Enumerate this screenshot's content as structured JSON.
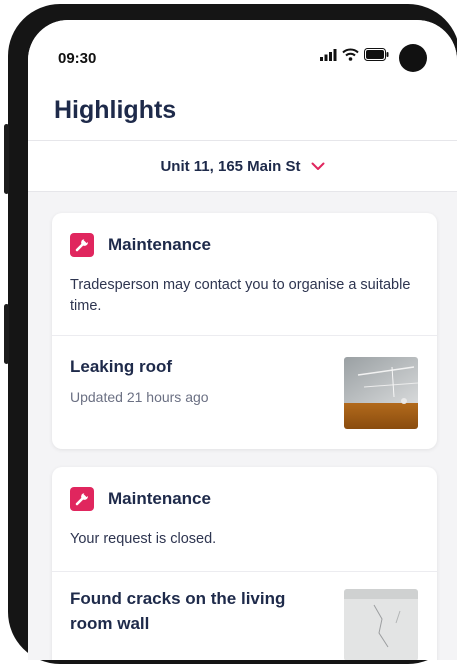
{
  "status_bar": {
    "time": "09:30"
  },
  "header": {
    "title": "Highlights"
  },
  "property_selector": {
    "label": "Unit 11, 165 Main St"
  },
  "cards": [
    {
      "type_label": "Maintenance",
      "message": "Tradesperson may contact you to organise a suitable time.",
      "item_title": "Leaking roof",
      "item_updated": "Updated 21 hours ago"
    },
    {
      "type_label": "Maintenance",
      "message": "Your request is closed.",
      "item_title": "Found cracks on the living room wall"
    }
  ],
  "colors": {
    "accent": "#e0265e",
    "title": "#1e2a4a",
    "background": "#f4f4f6"
  },
  "icons": [
    "signal-icon",
    "wifi-icon",
    "battery-icon",
    "chevron-down-icon",
    "wrench-icon"
  ]
}
